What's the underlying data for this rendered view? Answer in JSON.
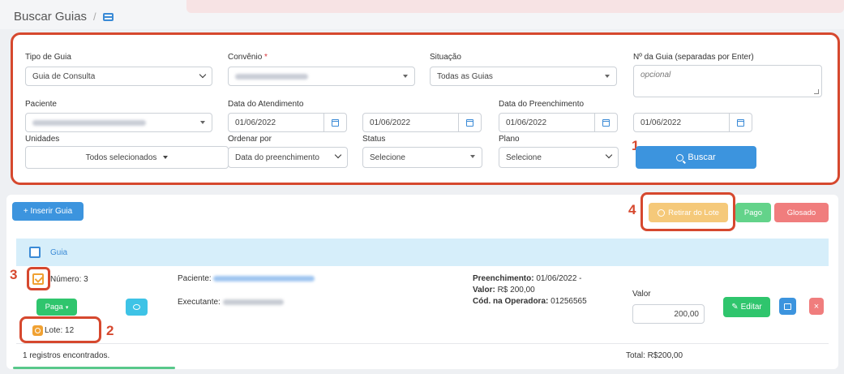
{
  "header": {
    "title": "Buscar Guias",
    "separator": "/"
  },
  "filters": {
    "tipo_guia": {
      "label": "Tipo de Guia",
      "value": "Guia de Consulta"
    },
    "convenio": {
      "label": "Convênio",
      "required_mark": "*"
    },
    "situacao": {
      "label": "Situação",
      "value": "Todas as Guias"
    },
    "numero_guia": {
      "label": "Nº da Guia (separadas por Enter)",
      "placeholder": "opcional"
    },
    "paciente": {
      "label": "Paciente"
    },
    "data_atendimento": {
      "label": "Data do Atendimento",
      "from": "01/06/2022",
      "to": "01/06/2022"
    },
    "data_preenchimento": {
      "label": "Data do Preenchimento",
      "from": "01/06/2022",
      "to": "01/06/2022"
    },
    "unidades": {
      "label": "Unidades",
      "value": "Todos selecionados"
    },
    "ordenar_por": {
      "label": "Ordenar por",
      "value": "Data do preenchimento"
    },
    "status": {
      "label": "Status",
      "value": "Selecione"
    },
    "plano": {
      "label": "Plano",
      "value": "Selecione"
    },
    "buscar_label": "Buscar"
  },
  "toolbar": {
    "inserir_label": "+ Inserir Guia",
    "retirar_label": "Retirar do Lote",
    "pago_label": "Pago",
    "glosado_label": "Glosado"
  },
  "table": {
    "header_label": "Guia",
    "rows": [
      {
        "numero": "Número: 3",
        "paciente_label": "Paciente:",
        "executante_label": "Executante:",
        "preenchimento_label": "Preenchimento:",
        "preenchimento_value": "01/06/2022 -",
        "valor_label": "Valor:",
        "valor_value": "R$ 200,00",
        "cod_label": "Cód. na Operadora:",
        "cod_value": "01256565",
        "valor_field_label": "Valor",
        "valor_field_value": "200,00",
        "status_button": "Paga",
        "lote_label": "Lote:",
        "lote_value": "12",
        "editar_label": "Editar",
        "delete_label": "×"
      }
    ],
    "footer_count": "1 registros encontrados.",
    "footer_total": "Total: R$200,00"
  },
  "annotations": [
    "1",
    "2",
    "3",
    "4"
  ],
  "colors": {
    "highlight": "#d6482e",
    "primary": "#3c94de",
    "success": "#2fc56d",
    "warning": "#f5c97a",
    "danger": "#f07d7d"
  }
}
